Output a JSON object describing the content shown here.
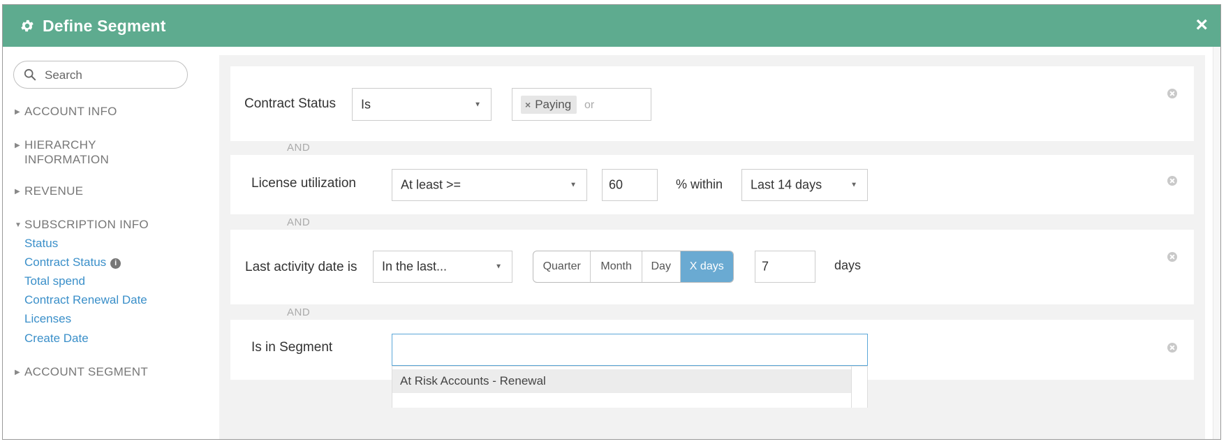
{
  "dialog": {
    "title": "Define Segment",
    "title_icon": "gear-icon",
    "close_label": "×"
  },
  "sidebar": {
    "search_placeholder": "Search",
    "sections": [
      {
        "label": "ACCOUNT INFO",
        "expanded": false
      },
      {
        "label": "HIERARCHY INFORMATION",
        "expanded": false
      },
      {
        "label": "REVENUE",
        "expanded": false
      },
      {
        "label": "SUBSCRIPTION INFO",
        "expanded": true
      },
      {
        "label": "ACCOUNT SEGMENT",
        "expanded": false
      }
    ],
    "subscription_items": [
      {
        "label": "Status"
      },
      {
        "label": "Contract Status",
        "has_info_icon": true
      },
      {
        "label": "Total spend"
      },
      {
        "label": "Contract Renewal Date"
      },
      {
        "label": "Licenses"
      },
      {
        "label": "Create Date"
      }
    ],
    "caret_collapsed": "▶",
    "caret_expanded": "▼",
    "info_glyph": "i"
  },
  "conditions": {
    "and_label": "AND",
    "contract_status": {
      "label": "Contract Status",
      "operator": "Is",
      "tags": [
        "Paying"
      ],
      "tag_remove": "×",
      "or_hint": "or"
    },
    "license_utilization": {
      "label": "License utilization",
      "operator": "At least >=",
      "value": "60",
      "unit_text": "% within",
      "period": "Last 14 days"
    },
    "last_activity": {
      "label": "Last activity date is",
      "operator": "In the last...",
      "range_options": [
        "Quarter",
        "Month",
        "Day",
        "X days"
      ],
      "selected_option": "X days",
      "value": "7",
      "unit_text": "days"
    },
    "segment": {
      "label": "Is in Segment",
      "input_value": "",
      "dropdown_options": [
        "At Risk Accounts - Renewal"
      ]
    }
  },
  "colors": {
    "header_bg": "#5eab8f",
    "link": "#3a8fc9",
    "active_toggle": "#6aaad2"
  }
}
